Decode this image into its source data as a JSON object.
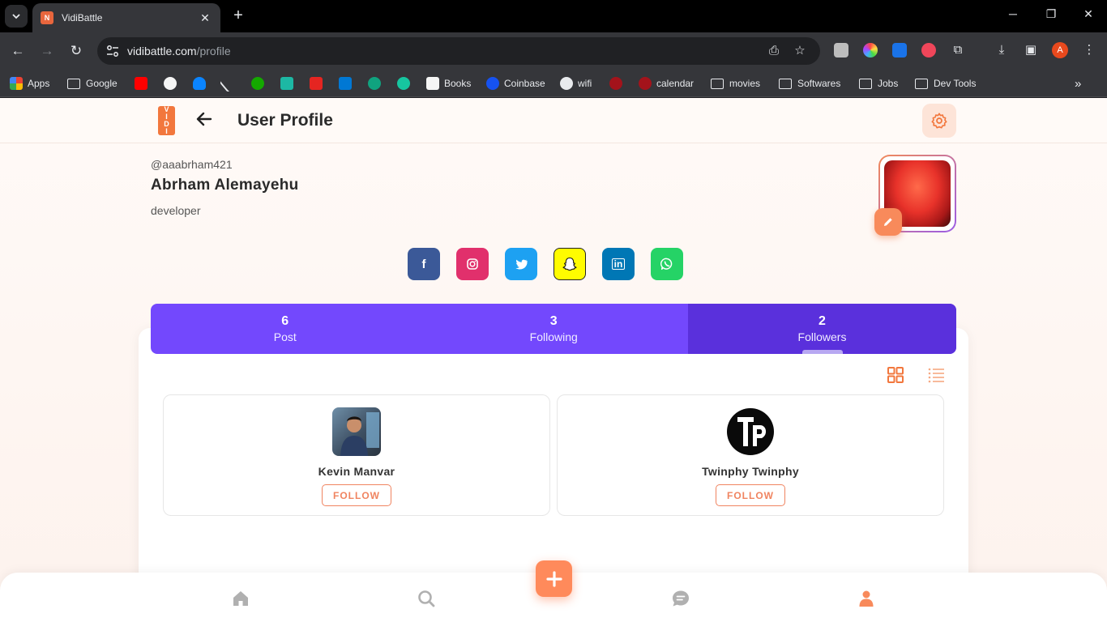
{
  "browser": {
    "tab_title": "VidiBattle",
    "tab_favicon_letter": "N",
    "url_host": "vidibattle.com",
    "url_path": "/profile",
    "profile_initial": "A",
    "bookmarks": [
      {
        "label": "Apps",
        "icon": "apps-grid-icon"
      },
      {
        "label": "Google",
        "icon": "folder-icon"
      },
      {
        "label": "Books",
        "icon": "books-icon"
      },
      {
        "label": "Coinbase",
        "icon": "coinbase-icon"
      },
      {
        "label": "wifi",
        "icon": "wifi-icon"
      },
      {
        "label": "calendar",
        "icon": "calendar-icon"
      },
      {
        "label": "movies",
        "icon": "folder-icon"
      },
      {
        "label": "Softwares",
        "icon": "folder-icon"
      },
      {
        "label": "Jobs",
        "icon": "folder-icon"
      },
      {
        "label": "Dev Tools",
        "icon": "folder-icon"
      }
    ]
  },
  "header": {
    "title": "User Profile",
    "logo_letters": [
      "V",
      "I",
      "D",
      "I"
    ]
  },
  "profile": {
    "handle": "@aaabrham421",
    "name": "Abrham Alemayehu",
    "bio": "developer"
  },
  "social": [
    {
      "name": "facebook",
      "glyph": "f",
      "color": "#3b5998"
    },
    {
      "name": "instagram",
      "glyph": "◎",
      "color": "#e1306c"
    },
    {
      "name": "twitter",
      "glyph": "🐦",
      "color": "#1da1f2"
    },
    {
      "name": "snapchat",
      "glyph": "👻",
      "color": "#fffc00"
    },
    {
      "name": "linkedin",
      "glyph": "in",
      "color": "#0077b5"
    },
    {
      "name": "whatsapp",
      "glyph": "✆",
      "color": "#25d366"
    }
  ],
  "stats": [
    {
      "count": "6",
      "label": "Post"
    },
    {
      "count": "3",
      "label": "Following"
    },
    {
      "count": "2",
      "label": "Followers"
    }
  ],
  "active_stat": "Followers",
  "followers": [
    {
      "name": "Kevin Manvar",
      "button": "FOLLOW"
    },
    {
      "name": "Twinphy Twinphy",
      "button": "FOLLOW"
    }
  ],
  "colors": {
    "accent": "#f88a5b",
    "stats_bg": "#7348fd",
    "stats_active": "#5a30dc"
  }
}
